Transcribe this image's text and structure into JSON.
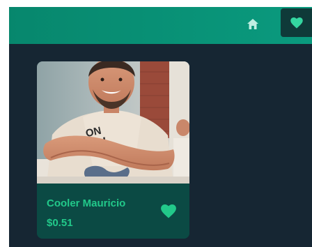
{
  "nav": {
    "home_icon": "home-icon",
    "favorites_icon": "heart-icon"
  },
  "colors": {
    "topbar": "#07876d",
    "background": "#162633",
    "card_footer": "#0b4a44",
    "accent": "#22c98a",
    "nav_active_bg": "#0f3a39"
  },
  "card": {
    "name": "Cooler Mauricio",
    "price": "$0.51",
    "favorite_icon": "heart-icon"
  }
}
